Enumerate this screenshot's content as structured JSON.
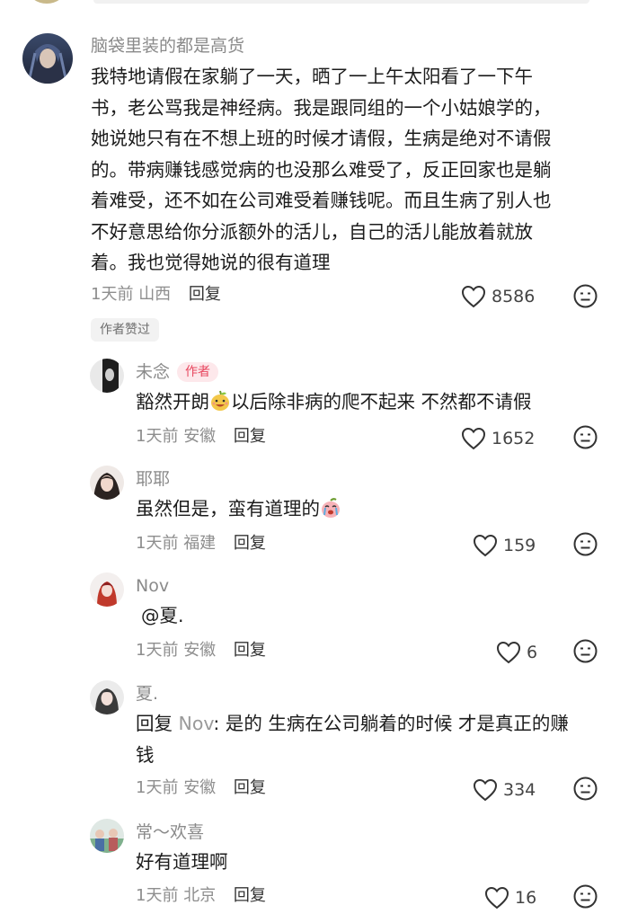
{
  "main_comment": {
    "username": "脑袋里装的都是高货",
    "lines": [
      "我特地请假在家躺了一天，晒了一上午太阳看了一下午",
      "书，老公骂我是神经病。我是跟同组的一个小姑娘学的，",
      "她说她只有在不想上班的时候才请假，生病是绝对不请假",
      "的。带病赚钱感觉病的也没那么难受了，反正回家也是躺",
      "着难受，还不如在公司难受着赚钱呢。而且生病了别人也",
      "不好意思给你分派额外的活儿，自己的活儿能放着就放",
      "着。我也觉得她说的很有道理"
    ],
    "time": "1天前",
    "location": "山西",
    "reply_label": "回复",
    "likes": "8586",
    "author_liked_badge": "作者赞过"
  },
  "replies": [
    {
      "username": "未念",
      "tag": "作者",
      "text_before_emoji": "豁然开朗",
      "text_after_emoji": "以后除非病的爬不起来 不然都不请假",
      "emoji": "grinning-pear-emoji",
      "time": "1天前",
      "location": "安徽",
      "reply_label": "回复",
      "likes": "1652"
    },
    {
      "username": "耶耶",
      "text_before_emoji": "虽然但是，蛮有道理的",
      "emoji": "crying-peach-emoji",
      "time": "1天前",
      "location": "福建",
      "reply_label": "回复",
      "likes": "159"
    },
    {
      "username": "Nov",
      "text": "@夏.",
      "time": "1天前",
      "location": "安徽",
      "reply_label": "回复",
      "likes": "6"
    },
    {
      "username": "夏.",
      "reply_prefix": "回复",
      "reply_to": "Nov",
      "line1": ": 是的 生病在公司躺着的时候 才是真正的赚",
      "line2": "钱",
      "time": "1天前",
      "location": "安徽",
      "reply_label": "回复",
      "likes": "334"
    },
    {
      "username": "常～欢喜",
      "text": "好有道理啊",
      "time": "1天前",
      "location": "北京",
      "reply_label": "回复",
      "likes": "16"
    }
  ],
  "icons": {
    "like": "heart-outline-icon",
    "dislike": "frown-face-icon"
  },
  "colors": {
    "author_tag_text": "#e8475f",
    "author_tag_bg": "#fde8eb",
    "username": "#8a8a8a",
    "meta": "#8e8e8e"
  }
}
